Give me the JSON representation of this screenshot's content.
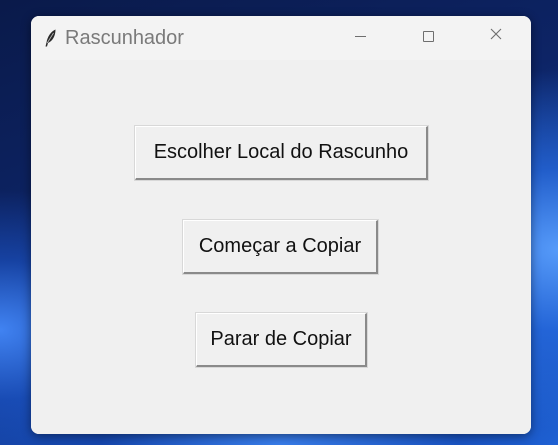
{
  "window": {
    "title": "Rascunhador",
    "icon": "feather-icon",
    "controls": {
      "minimize_icon": "minimize-icon",
      "maximize_icon": "maximize-icon",
      "close_icon": "close-icon"
    }
  },
  "buttons": {
    "choose_location": "Escolher Local do Rascunho",
    "start_copy": "Começar a Copiar",
    "stop_copy": "Parar de Copiar"
  }
}
